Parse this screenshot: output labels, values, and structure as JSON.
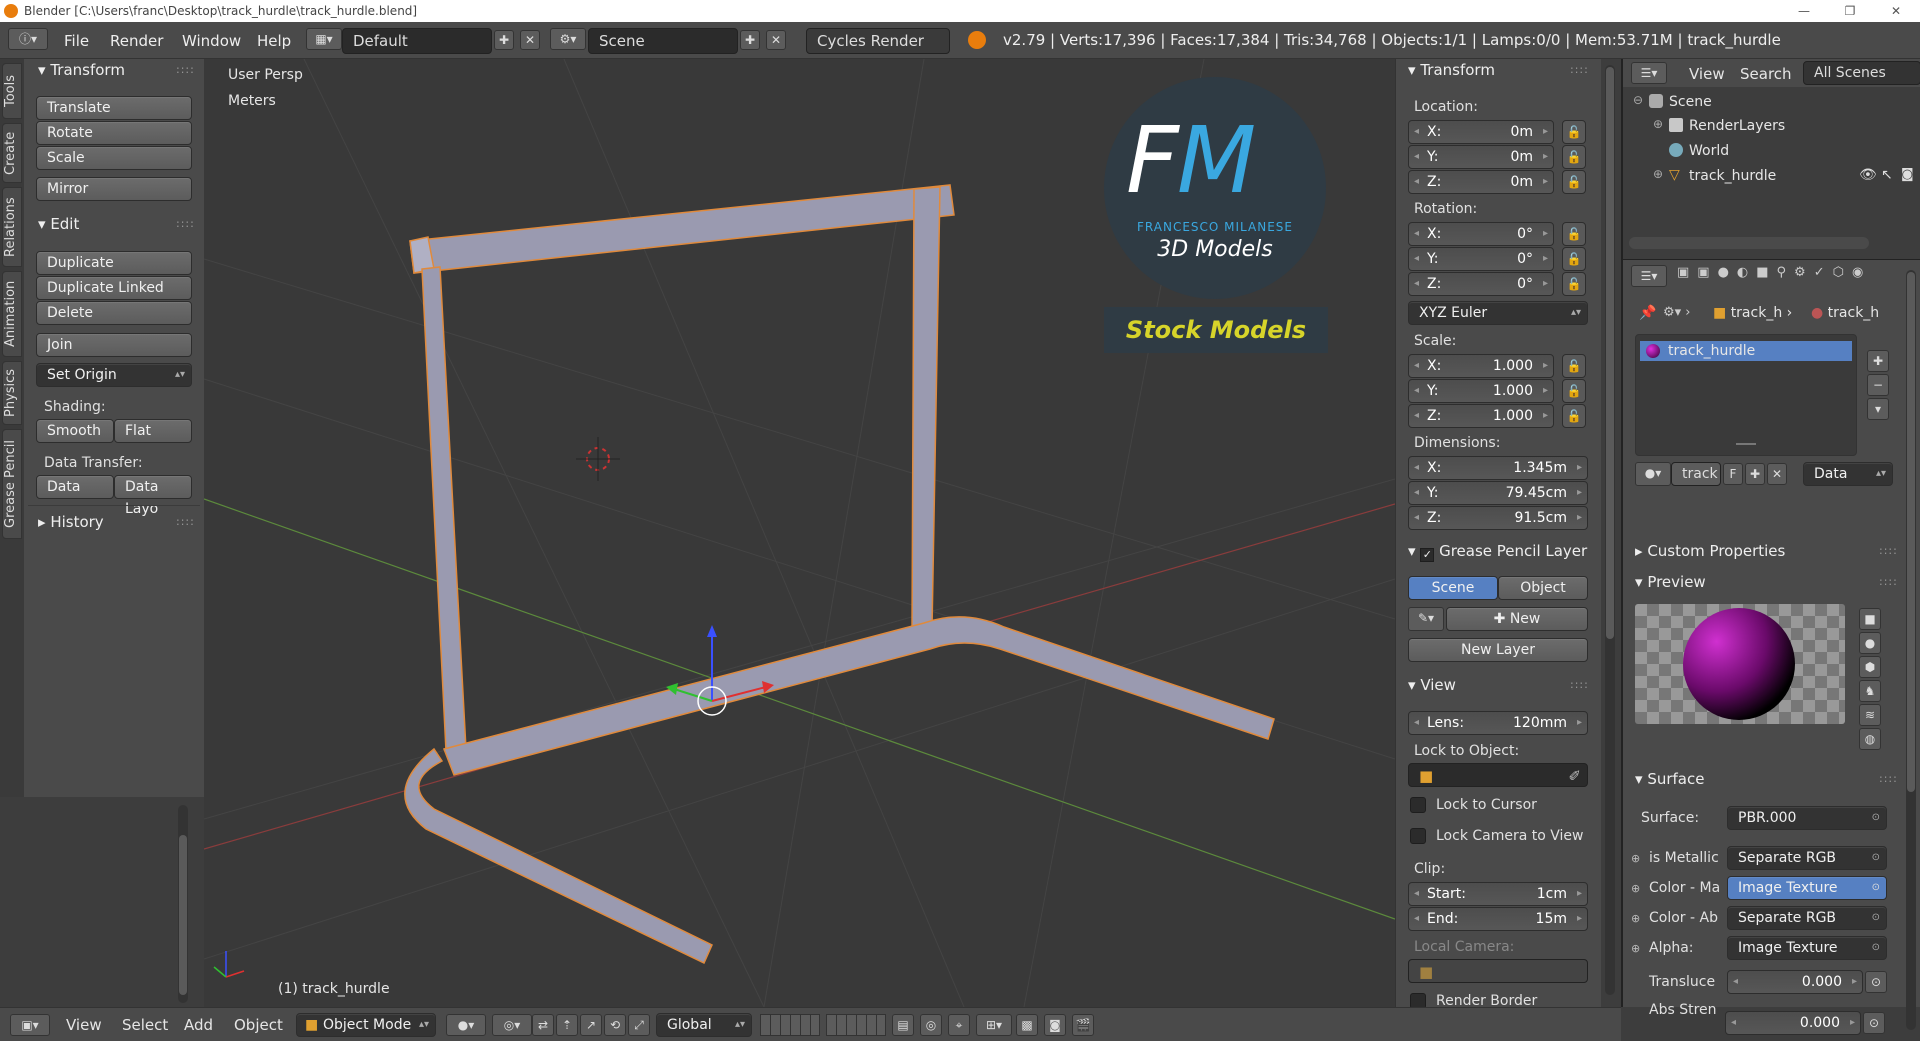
{
  "window": {
    "title": "Blender  [C:\\Users\\franc\\Desktop\\track_hurdle\\track_hurdle.blend]"
  },
  "menu": {
    "items": [
      "File",
      "Render",
      "Window",
      "Help"
    ]
  },
  "screen_layout": "Default",
  "scene": "Scene",
  "engine": "Cycles Render",
  "stats": "v2.79 | Verts:17,396 | Faces:17,384 | Tris:34,768 | Objects:1/1 | Lamps:0/0 | Mem:53.71M | track_hurdle",
  "tabs": [
    "Tools",
    "Create",
    "Relations",
    "Animation",
    "Physics",
    "Grease Pencil"
  ],
  "tool_shelf": {
    "transform_header": "Transform",
    "translate": "Translate",
    "rotate": "Rotate",
    "scale": "Scale",
    "mirror": "Mirror",
    "edit_header": "Edit",
    "duplicate": "Duplicate",
    "duplicate_linked": "Duplicate Linked",
    "delete": "Delete",
    "join": "Join",
    "set_origin": "Set Origin",
    "shading_label": "Shading:",
    "smooth": "Smooth",
    "flat": "Flat",
    "data_transfer_label": "Data Transfer:",
    "data": "Data",
    "data_layo": "Data Layo",
    "history": "History"
  },
  "viewport": {
    "view_name": "User Persp",
    "units": "Meters",
    "object_label": "(1) track_hurdle",
    "logo": {
      "initials": "FM",
      "name": "FRANCESCO MILANESE",
      "sub": "3D Models",
      "banner": "Stock Models"
    }
  },
  "properties_n": {
    "transform_header": "Transform",
    "location_label": "Location:",
    "location": [
      {
        "k": "X:",
        "v": "0m"
      },
      {
        "k": "Y:",
        "v": "0m"
      },
      {
        "k": "Z:",
        "v": "0m"
      }
    ],
    "rotation_label": "Rotation:",
    "rotation": [
      {
        "k": "X:",
        "v": "0°"
      },
      {
        "k": "Y:",
        "v": "0°"
      },
      {
        "k": "Z:",
        "v": "0°"
      }
    ],
    "rotation_mode": "XYZ Euler",
    "scale_label": "Scale:",
    "scale": [
      {
        "k": "X:",
        "v": "1.000"
      },
      {
        "k": "Y:",
        "v": "1.000"
      },
      {
        "k": "Z:",
        "v": "1.000"
      }
    ],
    "dimensions_label": "Dimensions:",
    "dimensions": [
      {
        "k": "X:",
        "v": "1.345m"
      },
      {
        "k": "Y:",
        "v": "79.45cm"
      },
      {
        "k": "Z:",
        "v": "91.5cm"
      }
    ],
    "gp_header": "Grease Pencil Layer",
    "gp_scene": "Scene",
    "gp_object": "Object",
    "gp_new": "New",
    "gp_new_layer": "New Layer",
    "view_header": "View",
    "lens_label": "Lens:",
    "lens": "120mm",
    "lock_obj_label": "Lock to Object:",
    "lock_cursor": "Lock to Cursor",
    "lock_camera": "Lock Camera to View",
    "clip_label": "Clip:",
    "clip_start_label": "Start:",
    "clip_start": "1cm",
    "clip_end_label": "End:",
    "clip_end": "15m",
    "local_camera": "Local Camera:",
    "render_border": "Render Border"
  },
  "outliner": {
    "view": "View",
    "search": "Search",
    "all_scenes": "All Scenes",
    "items": [
      "Scene",
      "RenderLayers",
      "World",
      "track_hurdle"
    ]
  },
  "properties": {
    "breadcrumb1": "track_h",
    "breadcrumb2": "track_h",
    "material_slot": "track_hurdle",
    "mat_name": "track",
    "mat_f": "F",
    "mat_link": "Data",
    "custom_props": "Custom Properties",
    "preview": "Preview",
    "surface_header": "Surface",
    "surface_label": "Surface:",
    "surface_value": "PBR.000",
    "inputs": [
      {
        "k": "is Metallic",
        "v": "Separate RGB"
      },
      {
        "k": "Color - Ma",
        "v": "Image Texture"
      },
      {
        "k": "Color - Ab",
        "v": "Separate RGB"
      },
      {
        "k": "Alpha:",
        "v": "Image Texture"
      }
    ],
    "transl_label": "Transluce",
    "transl_value": "0.000",
    "abs_label": "Abs Stren",
    "abs_value": "0.000"
  },
  "bottombar": {
    "view": "View",
    "select": "Select",
    "add": "Add",
    "object": "Object",
    "mode": "Object Mode",
    "orientation": "Global"
  }
}
